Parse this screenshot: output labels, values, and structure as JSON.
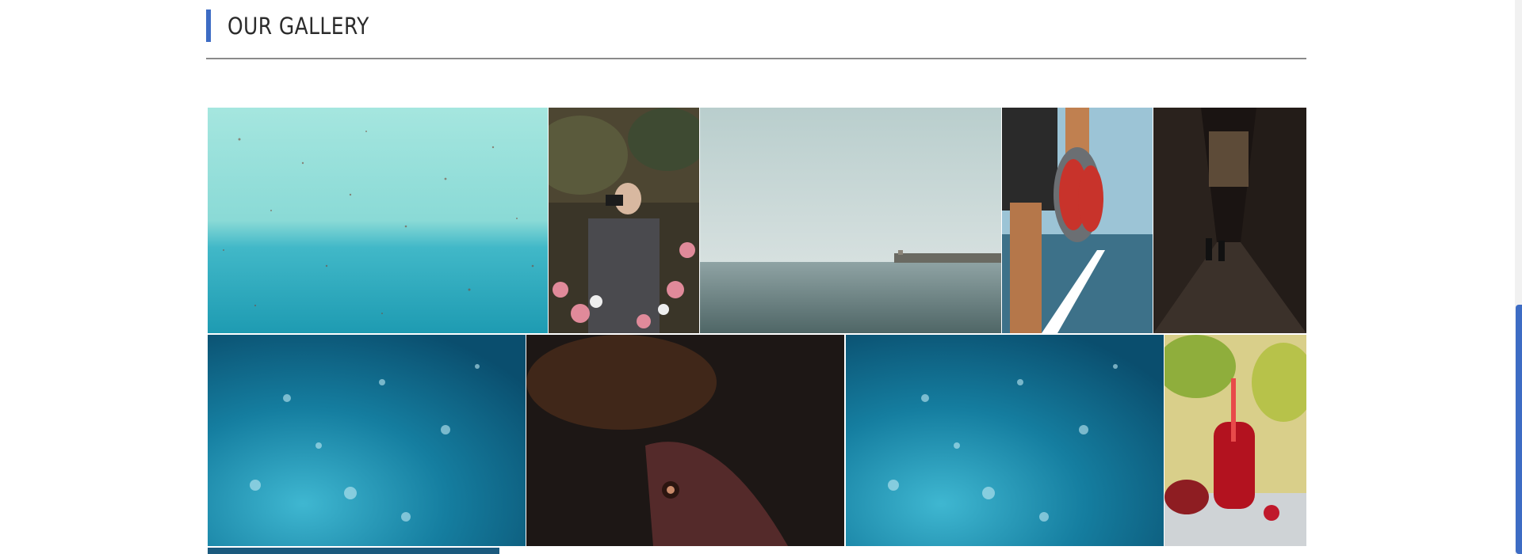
{
  "gallery": {
    "title": "OUR GALLERY",
    "accent_color": "#3d6cc4",
    "images": [
      {
        "name": "aqua-splatter-image"
      },
      {
        "name": "man-with-camera-in-flowers-image"
      },
      {
        "name": "calm-sea-coastal-town-image"
      },
      {
        "name": "person-holding-sneakers-image"
      },
      {
        "name": "night-alley-image"
      },
      {
        "name": "blue-bokeh-water-image"
      },
      {
        "name": "eye-closeup-dark-image"
      },
      {
        "name": "blue-bokeh-water-image-2"
      },
      {
        "name": "pomegranate-juice-image"
      },
      {
        "name": "partial-next-row-image"
      }
    ]
  }
}
